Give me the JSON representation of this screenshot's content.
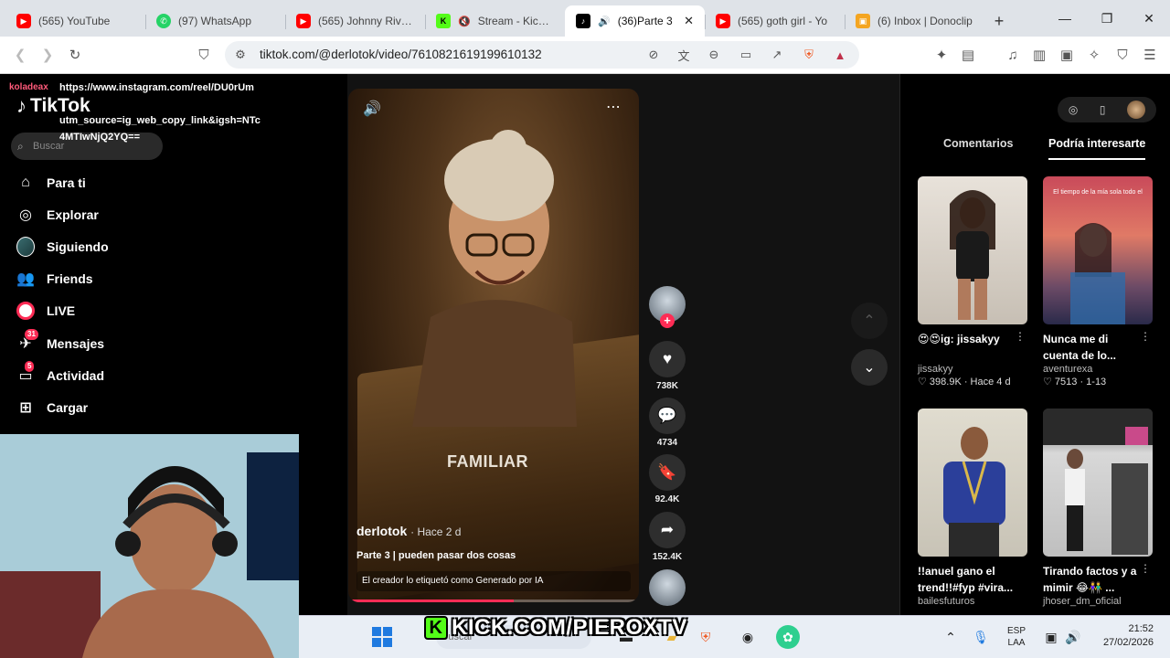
{
  "browser": {
    "tabs": [
      {
        "label": "(565) YouTube",
        "icon": "youtube-icon"
      },
      {
        "label": "(97) WhatsApp",
        "icon": "whatsapp-icon"
      },
      {
        "label": "(565) Johnny Rivera",
        "icon": "youtube-icon"
      },
      {
        "label": "Stream - Kick D",
        "icon": "kick-icon"
      },
      {
        "label": "(36)Parte 3",
        "icon": "tiktok-icon",
        "active": true
      },
      {
        "label": "(565) goth girl - Yo",
        "icon": "youtube-icon"
      },
      {
        "label": "(6) Inbox | Donoclip",
        "icon": "donoclip-icon"
      }
    ],
    "new_tab": "+",
    "url": "tiktok.com/@derlotok/video/7610821619199610132"
  },
  "overlay": {
    "username": "koladeax",
    "link_lines": [
      "https://www.instagram.com/reel/DU0rUm",
      "utm_source=ig_web_copy_link&igsh=NTc",
      "4MTIwNjQ2YQ=="
    ]
  },
  "sidebar": {
    "logo": "TikTok",
    "search_placeholder": "Buscar",
    "items": [
      {
        "label": "Para ti",
        "icon": "home-icon"
      },
      {
        "label": "Explorar",
        "icon": "compass-icon"
      },
      {
        "label": "Siguiendo",
        "icon": "following-avatar-icon"
      },
      {
        "label": "Friends",
        "icon": "friends-icon"
      },
      {
        "label": "LIVE",
        "icon": "live-icon"
      },
      {
        "label": "Mensajes",
        "icon": "messages-icon",
        "badge": "31"
      },
      {
        "label": "Actividad",
        "icon": "activity-icon",
        "badge": "5"
      },
      {
        "label": "Cargar",
        "icon": "upload-icon"
      }
    ]
  },
  "video": {
    "overlay_text": "FAMILIAR",
    "author": "derlotok",
    "posted": "· Hace 2 d",
    "caption": "Parte 3 | pueden pasar dos cosas",
    "ai_label": "El creador lo etiquetó como Generado por IA",
    "progress": 0.57
  },
  "actions": [
    {
      "name": "like",
      "icon": "heart-icon",
      "count": "738K"
    },
    {
      "name": "comment",
      "icon": "comment-icon",
      "count": "4734"
    },
    {
      "name": "save",
      "icon": "bookmark-icon",
      "count": "92.4K"
    },
    {
      "name": "share",
      "icon": "share-icon",
      "count": "152.4K"
    }
  ],
  "right_panel": {
    "tabs": [
      "Comentarios",
      "Podría interesarte"
    ],
    "active_tab": "Podría interesarte",
    "cards": [
      {
        "title": "😍😍ig: jissakyy",
        "user": "jissakyy",
        "meta": "♡ 398.9K · Hace 4 d",
        "thumb_overlay": ""
      },
      {
        "title": "Nunca me di cuenta de lo...",
        "user": "aventurexa",
        "meta": "♡ 7513 · 1-13",
        "thumb_overlay": "El tiempo de la mía sola todo el"
      },
      {
        "title": "!!anuel gano el trend!!#fyp #vira...",
        "user": "bailesfuturos",
        "meta": "",
        "thumb_overlay": ""
      },
      {
        "title": "Tirando factos y a mimir 😂👫 ...",
        "user": "jhoser_dm_oficial",
        "meta": "",
        "thumb_overlay": ""
      }
    ]
  },
  "stream": {
    "banner": "KICK.COM/PIEROXTV"
  },
  "taskbar": {
    "search_placeholder": "Buscar",
    "lang_top": "ESP",
    "lang_bottom": "LAA",
    "time": "21:52",
    "date": "27/02/2026"
  },
  "colors": {
    "tiktok_red": "#fe2c55",
    "kick_green": "#53fc18",
    "page_bg": "#121212"
  }
}
